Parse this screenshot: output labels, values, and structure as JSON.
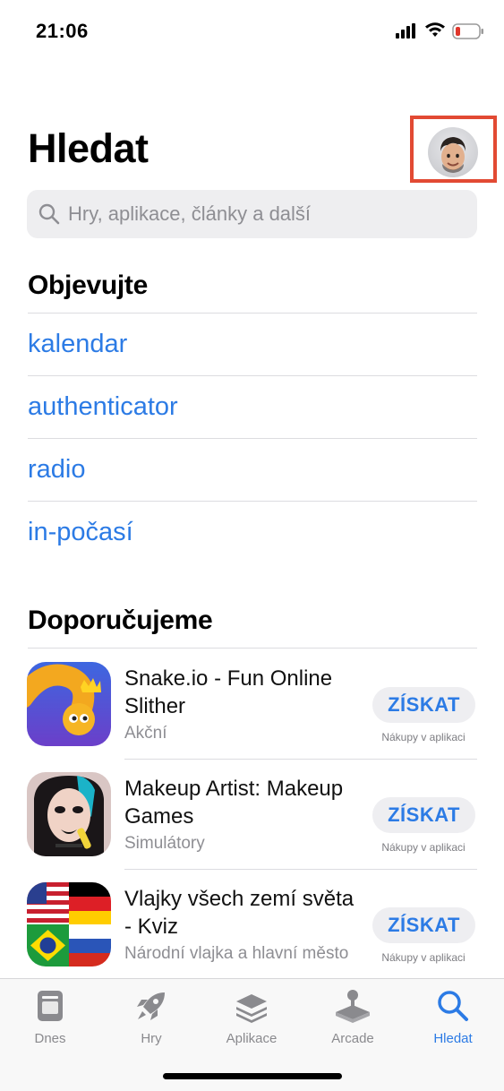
{
  "status_bar": {
    "time": "21:06"
  },
  "header": {
    "title": "Hledat"
  },
  "search": {
    "placeholder": "Hry, aplikace, články a další"
  },
  "discover": {
    "heading": "Objevujte",
    "items": [
      "kalendar",
      "authenticator",
      "radio",
      "in-počasí"
    ]
  },
  "recommended": {
    "heading": "Doporučujeme",
    "apps": [
      {
        "name": "Snake.io - Fun Online Slither",
        "category": "Akční",
        "button": "ZÍSKAT",
        "note": "Nákupy v aplikaci"
      },
      {
        "name": "Makeup Artist: Makeup Games",
        "category": "Simulátory",
        "button": "ZÍSKAT",
        "note": "Nákupy v aplikaci"
      },
      {
        "name": "Vlajky všech zemí světa - Kviz",
        "category": "Národní vlajka a hlavní město",
        "button": "ZÍSKAT",
        "note": "Nákupy v aplikaci"
      }
    ]
  },
  "tabbar": {
    "tabs": [
      {
        "label": "Dnes",
        "icon": "today-icon"
      },
      {
        "label": "Hry",
        "icon": "rocket-icon"
      },
      {
        "label": "Aplikace",
        "icon": "apps-stack-icon"
      },
      {
        "label": "Arcade",
        "icon": "joystick-icon"
      },
      {
        "label": "Hledat",
        "icon": "search-icon",
        "active": true
      }
    ]
  },
  "colors": {
    "accent": "#2c7be5",
    "highlight_box": "#e24a33"
  }
}
